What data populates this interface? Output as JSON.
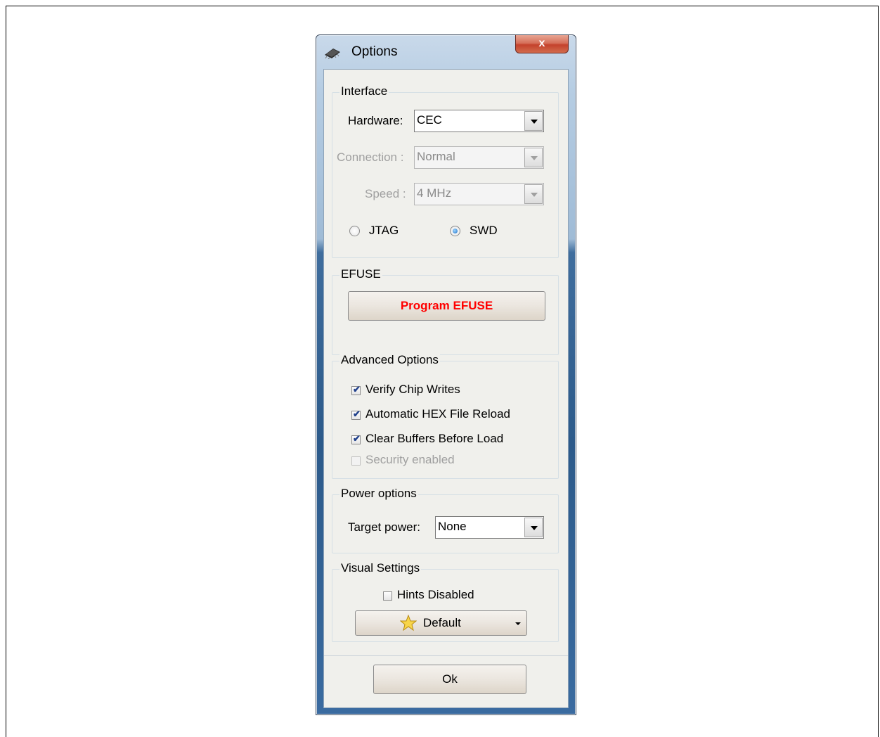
{
  "window": {
    "title": "Options",
    "close_glyph": "x",
    "icon": "chip-icon"
  },
  "interface": {
    "group_title": "Interface",
    "hardware_label": "Hardware:",
    "hardware_value": "CEC",
    "connection_label": "Connection :",
    "connection_value": "Normal",
    "speed_label": "Speed :",
    "speed_value": "4 MHz",
    "radio_jtag": "JTAG",
    "radio_swd": "SWD",
    "selected_protocol": "SWD"
  },
  "efuse": {
    "group_title": "EFUSE",
    "program_button": "Program EFUSE",
    "program_button_color": "#ff0000"
  },
  "advanced": {
    "group_title": "Advanced Options",
    "items": [
      {
        "label": "Verify Chip Writes",
        "checked": true,
        "enabled": true
      },
      {
        "label": "Automatic HEX File Reload",
        "checked": true,
        "enabled": true
      },
      {
        "label": "Clear Buffers Before Load",
        "checked": true,
        "enabled": true
      },
      {
        "label": "Security enabled",
        "checked": false,
        "enabled": false
      }
    ]
  },
  "power": {
    "group_title": "Power options",
    "target_label": "Target power:",
    "target_value": "None"
  },
  "visual": {
    "group_title": "Visual Settings",
    "hints_label": "Hints Disabled",
    "hints_checked": false,
    "theme_button": "Default",
    "theme_icon": "star-icon"
  },
  "footer": {
    "ok_button": "Ok"
  }
}
